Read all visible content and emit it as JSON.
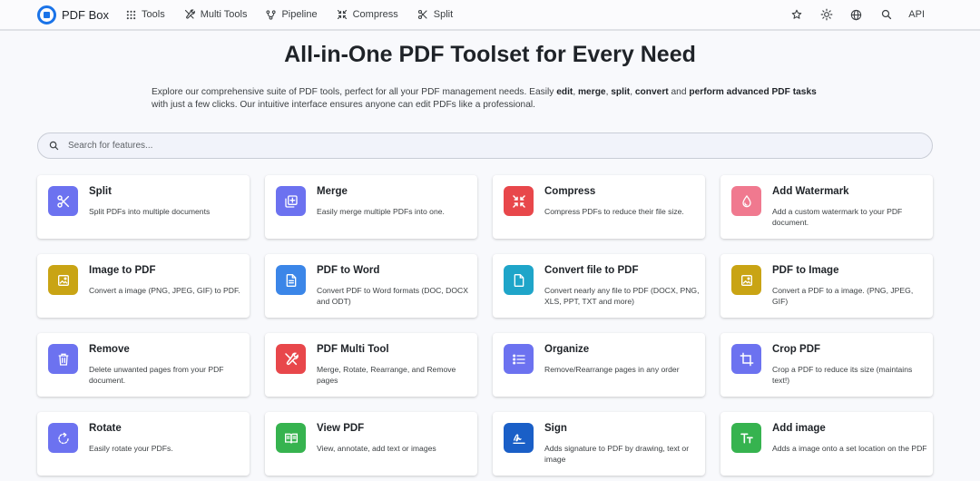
{
  "brand": {
    "name": "PDF Box",
    "accent": "#1a73e8"
  },
  "nav": {
    "items": [
      {
        "label": "Tools",
        "icon": "grid-icon"
      },
      {
        "label": "Multi Tools",
        "icon": "tools-icon"
      },
      {
        "label": "Pipeline",
        "icon": "pipeline-icon"
      },
      {
        "label": "Compress",
        "icon": "compress-icon"
      },
      {
        "label": "Split",
        "icon": "scissors-icon"
      }
    ],
    "right_icons": [
      "star-icon",
      "sun-icon",
      "globe-icon",
      "search-icon"
    ],
    "api_label": "API"
  },
  "hero": {
    "title": "All-in-One PDF Toolset for Every Need",
    "desc_parts": [
      {
        "text": "Explore our comprehensive suite of PDF tools, perfect for all your PDF management needs. Easily ",
        "bold": false
      },
      {
        "text": "edit",
        "bold": true
      },
      {
        "text": ", ",
        "bold": false
      },
      {
        "text": "merge",
        "bold": true
      },
      {
        "text": ", ",
        "bold": false
      },
      {
        "text": "split",
        "bold": true
      },
      {
        "text": ", ",
        "bold": false
      },
      {
        "text": "convert",
        "bold": true
      },
      {
        "text": " and ",
        "bold": false
      },
      {
        "text": "perform advanced PDF tasks",
        "bold": true
      },
      {
        "text": " with just a few clicks. Our intuitive interface ensures anyone can edit PDFs like a professional.",
        "bold": false
      }
    ]
  },
  "search": {
    "placeholder": "Search for features..."
  },
  "tools": [
    {
      "title": "Split",
      "desc": "Split PDFs into multiple documents",
      "icon": "scissors-icon",
      "color": "#6c72f0"
    },
    {
      "title": "Merge",
      "desc": "Easily merge multiple PDFs into one.",
      "icon": "merge-icon",
      "color": "#6c72f0"
    },
    {
      "title": "Compress",
      "desc": "Compress PDFs to reduce their file size.",
      "icon": "compress-icon",
      "color": "#e8474b"
    },
    {
      "title": "Add Watermark",
      "desc": "Add a custom watermark to your PDF document.",
      "icon": "watermark-icon",
      "color": "#f0798f"
    },
    {
      "title": "Image to PDF",
      "desc": "Convert a image (PNG, JPEG, GIF) to PDF.",
      "icon": "image-icon",
      "color": "#c9a414"
    },
    {
      "title": "PDF to Word",
      "desc": "Convert PDF to Word formats (DOC, DOCX and ODT)",
      "icon": "document-icon",
      "color": "#3b86e8"
    },
    {
      "title": "Convert file to PDF",
      "desc": "Convert nearly any file to PDF (DOCX, PNG, XLS, PPT, TXT and more)",
      "icon": "file-icon",
      "color": "#1fa5c9"
    },
    {
      "title": "PDF to Image",
      "desc": "Convert a PDF to a image. (PNG, JPEG, GIF)",
      "icon": "image-icon",
      "color": "#c9a414"
    },
    {
      "title": "Remove",
      "desc": "Delete unwanted pages from your PDF document.",
      "icon": "trash-icon",
      "color": "#6c72f0"
    },
    {
      "title": "PDF Multi Tool",
      "desc": "Merge, Rotate, Rearrange, and Remove pages",
      "icon": "tools-icon",
      "color": "#e8474b"
    },
    {
      "title": "Organize",
      "desc": "Remove/Rearrange pages in any order",
      "icon": "list-icon",
      "color": "#6c72f0"
    },
    {
      "title": "Crop PDF",
      "desc": "Crop a PDF to reduce its size (maintains text!)",
      "icon": "crop-icon",
      "color": "#6c72f0"
    },
    {
      "title": "Rotate",
      "desc": "Easily rotate your PDFs.",
      "icon": "rotate-icon",
      "color": "#6c72f0"
    },
    {
      "title": "View PDF",
      "desc": "View, annotate, add text or images",
      "icon": "book-icon",
      "color": "#36b34f"
    },
    {
      "title": "Sign",
      "desc": "Adds signature to PDF by drawing, text or image",
      "icon": "signature-icon",
      "color": "#1a5fc7"
    },
    {
      "title": "Add image",
      "desc": "Adds a image onto a set location on the PDF",
      "icon": "text-icon",
      "color": "#36b34f"
    }
  ]
}
